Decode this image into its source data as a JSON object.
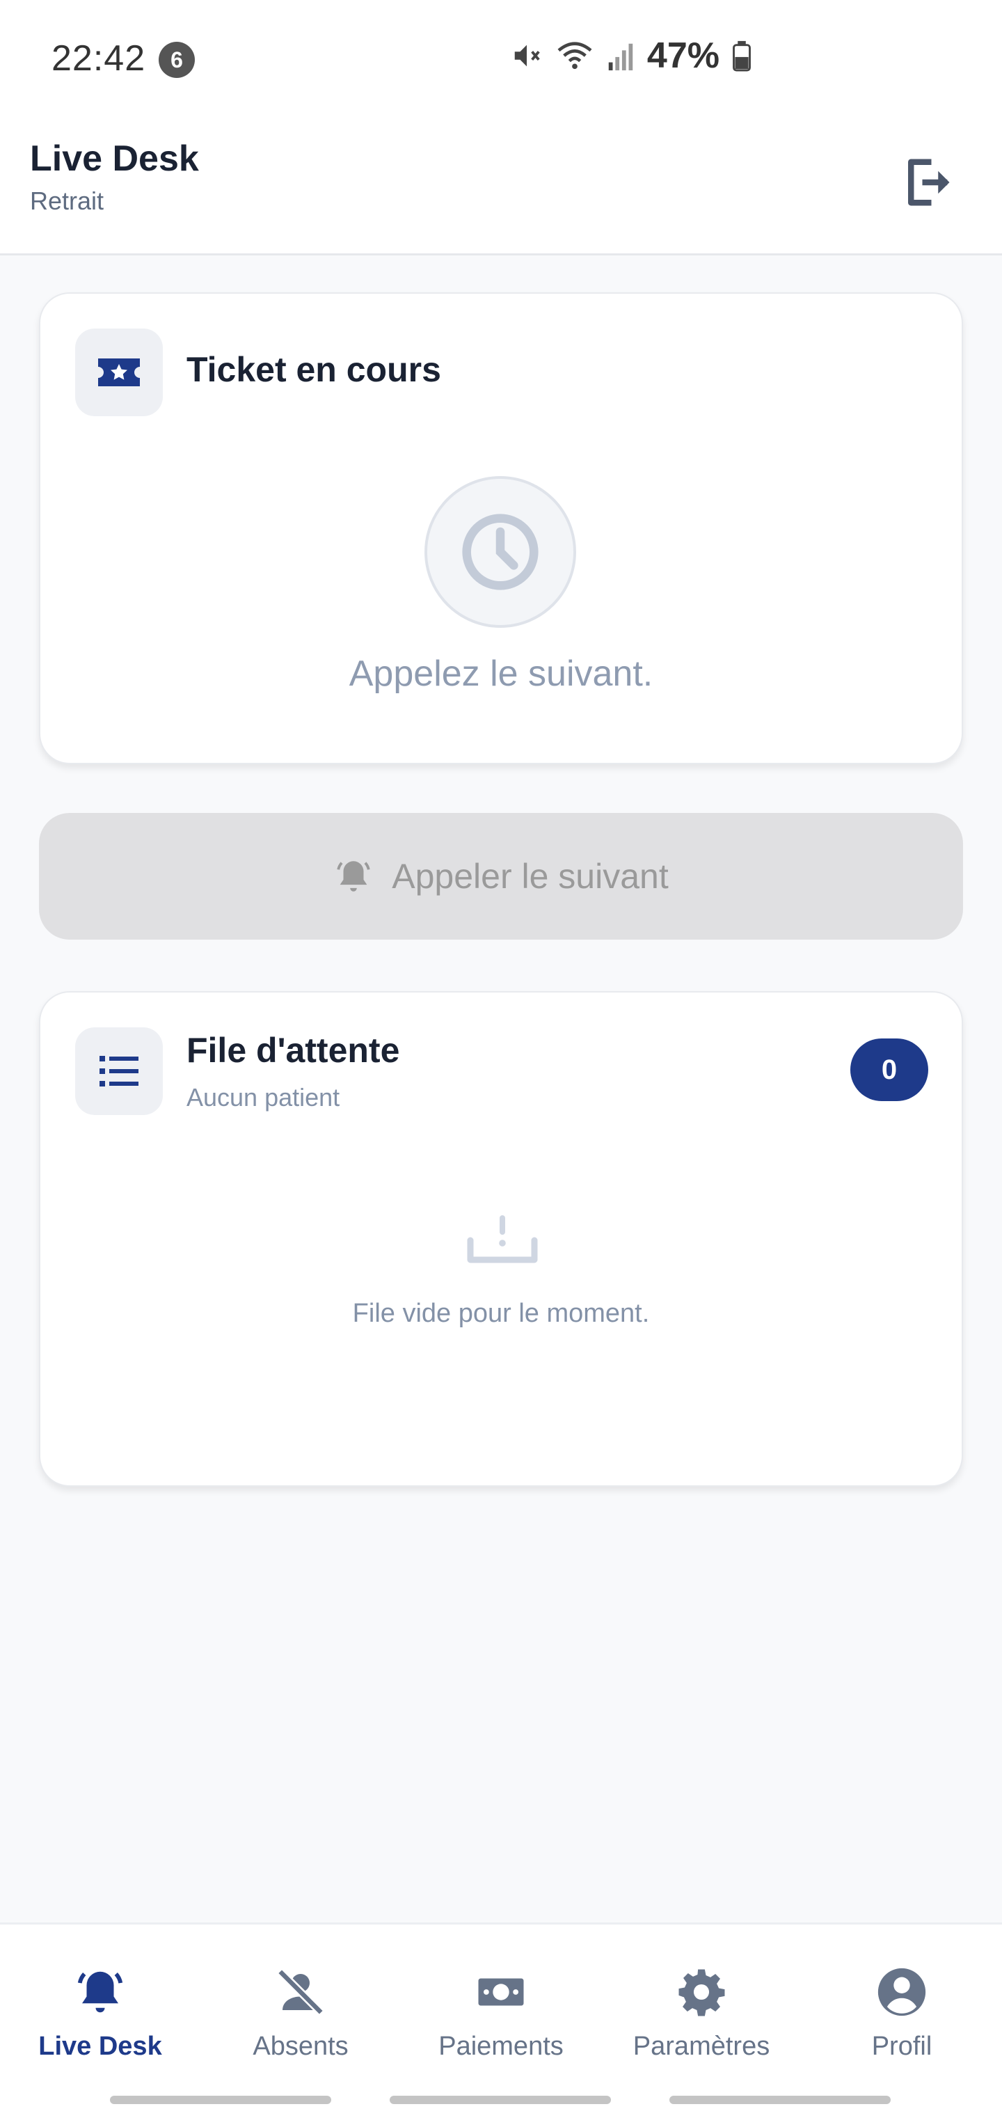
{
  "status_bar": {
    "time": "22:42",
    "notification_count": "6",
    "battery": "47%"
  },
  "header": {
    "title": "Live Desk",
    "subtitle": "Retrait"
  },
  "ticket_card": {
    "title": "Ticket en cours",
    "empty_message": "Appelez le suivant."
  },
  "call_button": {
    "label": "Appeler le suivant"
  },
  "queue_card": {
    "title": "File d'attente",
    "subtitle": "Aucun patient",
    "count": "0",
    "empty_message": "File vide pour le moment."
  },
  "bottom_nav": {
    "items": [
      {
        "label": "Live Desk",
        "icon": "bell-icon",
        "active": true
      },
      {
        "label": "Absents",
        "icon": "person-off-icon",
        "active": false
      },
      {
        "label": "Paiements",
        "icon": "money-icon",
        "active": false
      },
      {
        "label": "Paramètres",
        "icon": "gear-icon",
        "active": false
      },
      {
        "label": "Profil",
        "icon": "account-circle-icon",
        "active": false
      }
    ]
  },
  "colors": {
    "accent": "#1e3a8a",
    "muted": "#8e9bb0",
    "disabled_bg": "#e0e0e2"
  }
}
